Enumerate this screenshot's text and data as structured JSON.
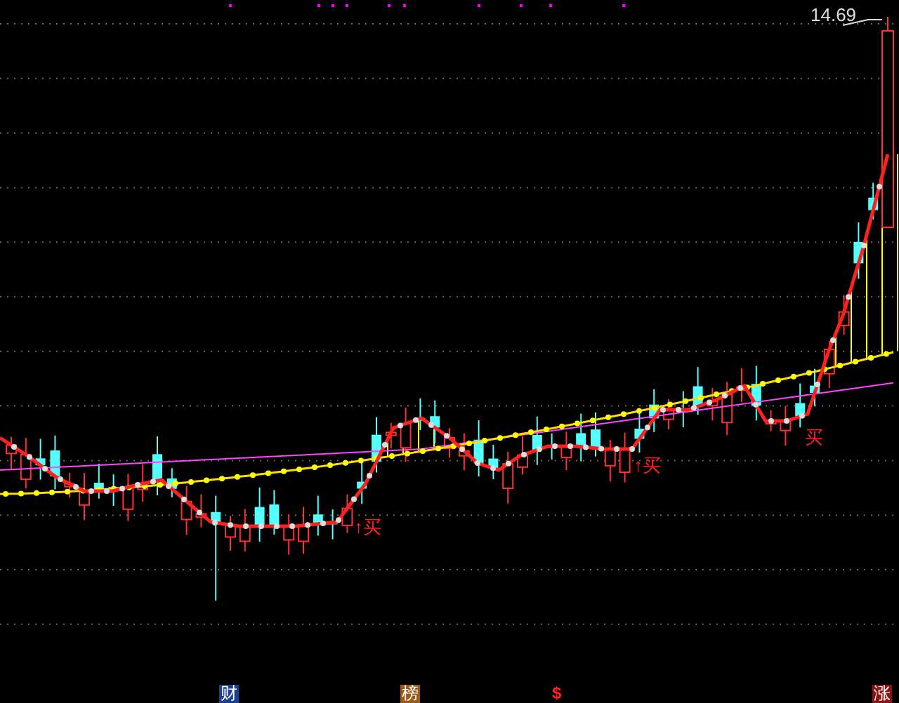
{
  "chart": {
    "price_label": "14.69",
    "buy_signals": [
      "↑买",
      "↑买",
      "买"
    ]
  },
  "bottom_markers": [
    {
      "text": "财",
      "kind": "badge",
      "color": "#1c3f8f"
    },
    {
      "text": "榜",
      "kind": "badge",
      "color": "#9a5a1c"
    },
    {
      "text": "$",
      "kind": "plain",
      "color": "#ff2020"
    },
    {
      "text": "涨",
      "kind": "badge",
      "color": "#8a1414"
    }
  ]
}
